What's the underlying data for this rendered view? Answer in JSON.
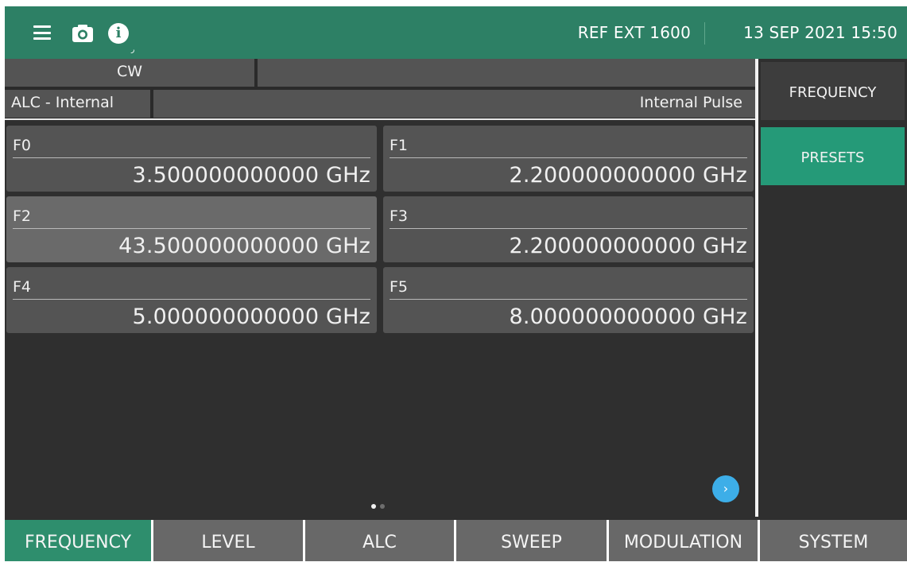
{
  "topbar": {
    "ref": "REF EXT 1600",
    "datetime": "13 SEP 2021 15:50",
    "info_mini": "ر"
  },
  "status": {
    "mode": "CW",
    "alc": "ALC - Internal",
    "pulse": "Internal Pulse"
  },
  "presets": [
    {
      "label": "F0",
      "value": "3.500000000000 GHz"
    },
    {
      "label": "F1",
      "value": "2.200000000000 GHz"
    },
    {
      "label": "F2",
      "value": "43.500000000000 GHz"
    },
    {
      "label": "F3",
      "value": "2.200000000000 GHz"
    },
    {
      "label": "F4",
      "value": "5.000000000000 GHz"
    },
    {
      "label": "F5",
      "value": "8.000000000000 GHz"
    }
  ],
  "next_button": "›",
  "side_menu": [
    {
      "label": "FREQUENCY"
    },
    {
      "label": "PRESETS"
    }
  ],
  "tabs": [
    {
      "label": "FREQUENCY"
    },
    {
      "label": "LEVEL"
    },
    {
      "label": "ALC"
    },
    {
      "label": "SWEEP"
    },
    {
      "label": "MODULATION"
    },
    {
      "label": "SYSTEM"
    }
  ],
  "colors": {
    "brand_green": "#2d8065",
    "active_green": "#259a78",
    "accent_blue": "#3daee8"
  },
  "icons": [
    "menu-icon",
    "camera-icon",
    "info-icon",
    "chevron-right-icon"
  ]
}
